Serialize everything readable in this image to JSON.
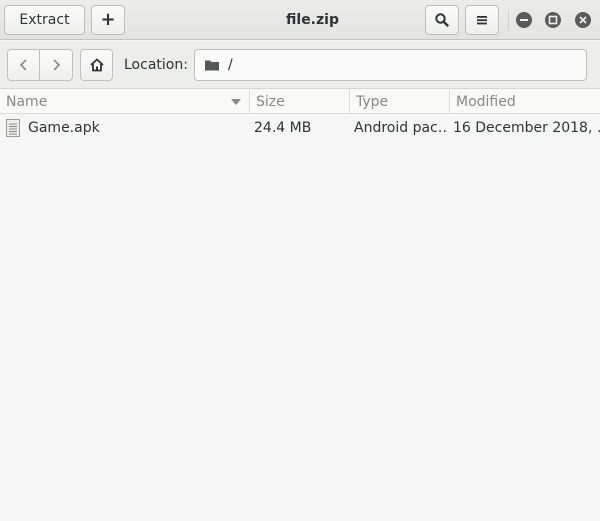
{
  "header": {
    "extract_label": "Extract",
    "add_label": "+",
    "title": "file.zip"
  },
  "location": {
    "label": "Location:",
    "path": "/"
  },
  "columns": {
    "name": "Name",
    "size": "Size",
    "type": "Type",
    "modified": "Modified"
  },
  "files": [
    {
      "name": "Game.apk",
      "size": "24.4 MB",
      "type": "Android pac…",
      "modified": "16 December 2018, …",
      "icon": "document-icon"
    }
  ],
  "colors": {
    "header_bg": "#e8e8e6",
    "text": "#2e3436",
    "column_header_text": "#888a85"
  }
}
